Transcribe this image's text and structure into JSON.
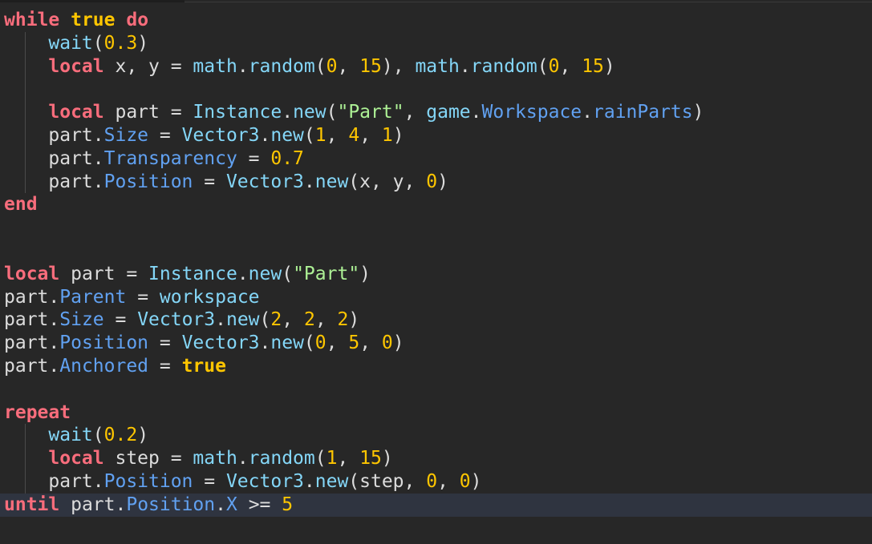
{
  "code": {
    "lines": [
      [
        {
          "t": "while",
          "c": "kw"
        },
        {
          "t": " ",
          "c": "op"
        },
        {
          "t": "true",
          "c": "bool"
        },
        {
          "t": " ",
          "c": "op"
        },
        {
          "t": "do",
          "c": "kw"
        }
      ],
      [
        {
          "t": "    ",
          "c": "op"
        },
        {
          "t": "wait",
          "c": "builtin"
        },
        {
          "t": "(",
          "c": "op"
        },
        {
          "t": "0.3",
          "c": "num"
        },
        {
          "t": ")",
          "c": "op"
        }
      ],
      [
        {
          "t": "    ",
          "c": "op"
        },
        {
          "t": "local",
          "c": "kw"
        },
        {
          "t": " x, y = ",
          "c": "ident"
        },
        {
          "t": "math",
          "c": "builtin"
        },
        {
          "t": ".",
          "c": "op"
        },
        {
          "t": "random",
          "c": "builtin"
        },
        {
          "t": "(",
          "c": "op"
        },
        {
          "t": "0",
          "c": "num"
        },
        {
          "t": ", ",
          "c": "op"
        },
        {
          "t": "15",
          "c": "num"
        },
        {
          "t": "), ",
          "c": "op"
        },
        {
          "t": "math",
          "c": "builtin"
        },
        {
          "t": ".",
          "c": "op"
        },
        {
          "t": "random",
          "c": "builtin"
        },
        {
          "t": "(",
          "c": "op"
        },
        {
          "t": "0",
          "c": "num"
        },
        {
          "t": ", ",
          "c": "op"
        },
        {
          "t": "15",
          "c": "num"
        },
        {
          "t": ")",
          "c": "op"
        }
      ],
      [],
      [
        {
          "t": "    ",
          "c": "op"
        },
        {
          "t": "local",
          "c": "kw"
        },
        {
          "t": " part = ",
          "c": "ident"
        },
        {
          "t": "Instance",
          "c": "builtin"
        },
        {
          "t": ".",
          "c": "op"
        },
        {
          "t": "new",
          "c": "builtin"
        },
        {
          "t": "(",
          "c": "op"
        },
        {
          "t": "\"Part\"",
          "c": "str"
        },
        {
          "t": ", ",
          "c": "op"
        },
        {
          "t": "game",
          "c": "builtin"
        },
        {
          "t": ".",
          "c": "op"
        },
        {
          "t": "Workspace",
          "c": "prop"
        },
        {
          "t": ".",
          "c": "op"
        },
        {
          "t": "rainParts",
          "c": "prop"
        },
        {
          "t": ")",
          "c": "op"
        }
      ],
      [
        {
          "t": "    part.",
          "c": "ident"
        },
        {
          "t": "Size",
          "c": "prop"
        },
        {
          "t": " = ",
          "c": "op"
        },
        {
          "t": "Vector3",
          "c": "builtin"
        },
        {
          "t": ".",
          "c": "op"
        },
        {
          "t": "new",
          "c": "builtin"
        },
        {
          "t": "(",
          "c": "op"
        },
        {
          "t": "1",
          "c": "num"
        },
        {
          "t": ", ",
          "c": "op"
        },
        {
          "t": "4",
          "c": "num"
        },
        {
          "t": ", ",
          "c": "op"
        },
        {
          "t": "1",
          "c": "num"
        },
        {
          "t": ")",
          "c": "op"
        }
      ],
      [
        {
          "t": "    part.",
          "c": "ident"
        },
        {
          "t": "Transparency",
          "c": "prop"
        },
        {
          "t": " = ",
          "c": "op"
        },
        {
          "t": "0.7",
          "c": "num"
        }
      ],
      [
        {
          "t": "    part.",
          "c": "ident"
        },
        {
          "t": "Position",
          "c": "prop"
        },
        {
          "t": " = ",
          "c": "op"
        },
        {
          "t": "Vector3",
          "c": "builtin"
        },
        {
          "t": ".",
          "c": "op"
        },
        {
          "t": "new",
          "c": "builtin"
        },
        {
          "t": "(x, y, ",
          "c": "op"
        },
        {
          "t": "0",
          "c": "num"
        },
        {
          "t": ")",
          "c": "op"
        }
      ],
      [
        {
          "t": "end",
          "c": "kw"
        }
      ],
      [],
      [],
      [
        {
          "t": "local",
          "c": "kw"
        },
        {
          "t": " part = ",
          "c": "ident"
        },
        {
          "t": "Instance",
          "c": "builtin"
        },
        {
          "t": ".",
          "c": "op"
        },
        {
          "t": "new",
          "c": "builtin"
        },
        {
          "t": "(",
          "c": "op"
        },
        {
          "t": "\"Part\"",
          "c": "str"
        },
        {
          "t": ")",
          "c": "op"
        }
      ],
      [
        {
          "t": "part.",
          "c": "ident"
        },
        {
          "t": "Parent",
          "c": "prop"
        },
        {
          "t": " = ",
          "c": "op"
        },
        {
          "t": "workspace",
          "c": "builtin"
        }
      ],
      [
        {
          "t": "part.",
          "c": "ident"
        },
        {
          "t": "Size",
          "c": "prop"
        },
        {
          "t": " = ",
          "c": "op"
        },
        {
          "t": "Vector3",
          "c": "builtin"
        },
        {
          "t": ".",
          "c": "op"
        },
        {
          "t": "new",
          "c": "builtin"
        },
        {
          "t": "(",
          "c": "op"
        },
        {
          "t": "2",
          "c": "num"
        },
        {
          "t": ", ",
          "c": "op"
        },
        {
          "t": "2",
          "c": "num"
        },
        {
          "t": ", ",
          "c": "op"
        },
        {
          "t": "2",
          "c": "num"
        },
        {
          "t": ")",
          "c": "op"
        }
      ],
      [
        {
          "t": "part.",
          "c": "ident"
        },
        {
          "t": "Position",
          "c": "prop"
        },
        {
          "t": " = ",
          "c": "op"
        },
        {
          "t": "Vector3",
          "c": "builtin"
        },
        {
          "t": ".",
          "c": "op"
        },
        {
          "t": "new",
          "c": "builtin"
        },
        {
          "t": "(",
          "c": "op"
        },
        {
          "t": "0",
          "c": "num"
        },
        {
          "t": ", ",
          "c": "op"
        },
        {
          "t": "5",
          "c": "num"
        },
        {
          "t": ", ",
          "c": "op"
        },
        {
          "t": "0",
          "c": "num"
        },
        {
          "t": ")",
          "c": "op"
        }
      ],
      [
        {
          "t": "part.",
          "c": "ident"
        },
        {
          "t": "Anchored",
          "c": "prop"
        },
        {
          "t": " = ",
          "c": "op"
        },
        {
          "t": "true",
          "c": "bool"
        }
      ],
      [],
      [
        {
          "t": "repeat",
          "c": "kw"
        }
      ],
      [
        {
          "t": "    ",
          "c": "op"
        },
        {
          "t": "wait",
          "c": "builtin"
        },
        {
          "t": "(",
          "c": "op"
        },
        {
          "t": "0.2",
          "c": "num"
        },
        {
          "t": ")",
          "c": "op"
        }
      ],
      [
        {
          "t": "    ",
          "c": "op"
        },
        {
          "t": "local",
          "c": "kw"
        },
        {
          "t": " step = ",
          "c": "ident"
        },
        {
          "t": "math",
          "c": "builtin"
        },
        {
          "t": ".",
          "c": "op"
        },
        {
          "t": "random",
          "c": "builtin"
        },
        {
          "t": "(",
          "c": "op"
        },
        {
          "t": "1",
          "c": "num"
        },
        {
          "t": ", ",
          "c": "op"
        },
        {
          "t": "15",
          "c": "num"
        },
        {
          "t": ")",
          "c": "op"
        }
      ],
      [
        {
          "t": "    part.",
          "c": "ident"
        },
        {
          "t": "Position",
          "c": "prop"
        },
        {
          "t": " = ",
          "c": "op"
        },
        {
          "t": "Vector3",
          "c": "builtin"
        },
        {
          "t": ".",
          "c": "op"
        },
        {
          "t": "new",
          "c": "builtin"
        },
        {
          "t": "(step, ",
          "c": "op"
        },
        {
          "t": "0",
          "c": "num"
        },
        {
          "t": ", ",
          "c": "op"
        },
        {
          "t": "0",
          "c": "num"
        },
        {
          "t": ")",
          "c": "op"
        }
      ],
      [
        {
          "t": "until",
          "c": "kw"
        },
        {
          "t": " part.",
          "c": "ident"
        },
        {
          "t": "Position",
          "c": "prop"
        },
        {
          "t": ".",
          "c": "op"
        },
        {
          "t": "X",
          "c": "prop"
        },
        {
          "t": " >= ",
          "c": "op"
        },
        {
          "t": "5",
          "c": "num"
        }
      ]
    ],
    "current_line": 21
  },
  "colors": {
    "background": "#272727",
    "keyword": "#f86d7c",
    "boolean": "#ffc600",
    "number": "#ffc600",
    "string": "#adf195",
    "property": "#61a1f1",
    "builtin": "#84d6f7",
    "text": "#dcdcdc",
    "current_line": "#2f3440"
  }
}
